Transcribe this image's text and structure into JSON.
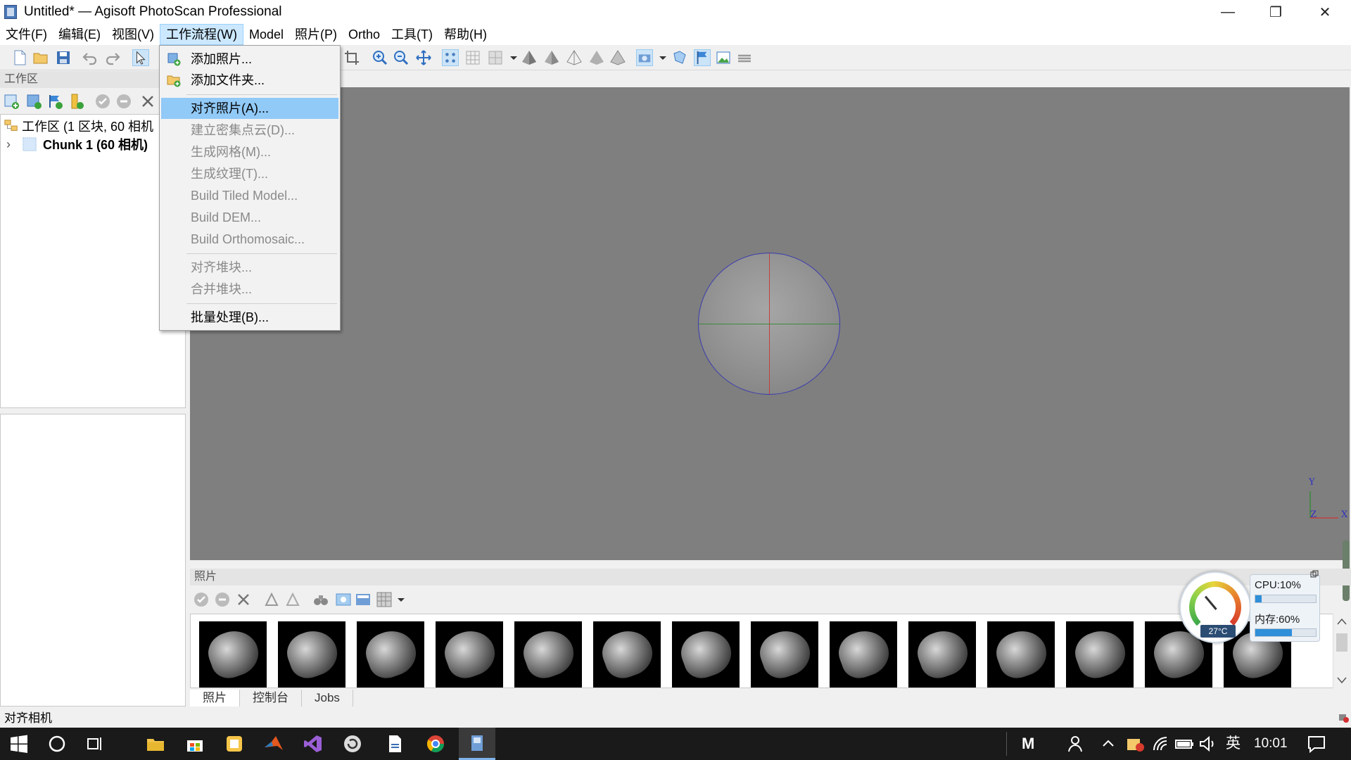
{
  "window": {
    "title": "Untitled* — Agisoft PhotoScan Professional",
    "controls": {
      "minimize": "—",
      "maximize": "❐",
      "close": "✕"
    }
  },
  "menubar": {
    "items": [
      {
        "label": "文件(F)"
      },
      {
        "label": "编辑(E)"
      },
      {
        "label": "视图(V)"
      },
      {
        "label": "工作流程(W)"
      },
      {
        "label": "Model"
      },
      {
        "label": "照片(P)"
      },
      {
        "label": "Ortho"
      },
      {
        "label": "工具(T)"
      },
      {
        "label": "帮助(H)"
      }
    ]
  },
  "workflow_menu": {
    "add_photos": "添加照片...",
    "add_folder": "添加文件夹...",
    "align_photos": "对齐照片(A)...",
    "build_dense_cloud": "建立密集点云(D)...",
    "build_mesh": "生成网格(M)...",
    "build_texture": "生成纹理(T)...",
    "build_tiled_model": "Build Tiled Model...",
    "build_dem": "Build DEM...",
    "build_orthomosaic": "Build Orthomosaic...",
    "align_chunks": "对齐堆块...",
    "merge_chunks": "合并堆块...",
    "batch_process": "批量处理(B)..."
  },
  "workspace": {
    "header": "工作区",
    "root_label": "工作区 (1 区块, 60 相机",
    "chunk_label": "Chunk 1 (60 相机)",
    "expand_glyph": "›"
  },
  "viewport": {
    "axes": {
      "y": "Y",
      "z": "Z",
      "x": "X"
    }
  },
  "photos_panel": {
    "header": "照片",
    "tabs": [
      "照片",
      "控制台",
      "Jobs"
    ],
    "thumbnail_count": 14
  },
  "status": {
    "text": "对齐相机"
  },
  "monitor": {
    "cpu_label": "CPU:10%",
    "mem_label": "内存:60%",
    "cpu_fraction": 0.1,
    "mem_fraction": 0.6,
    "temperature": "27°C"
  },
  "taskbar": {
    "ime": "英",
    "time": "10:01",
    "m_label": "M"
  },
  "colors": {
    "viewport_bg": "#7f7f7f",
    "menu_highlight": "#91c9f7",
    "active_menu": "#cce8ff",
    "axis_x": "#c24040",
    "axis_y": "#3c8a3c",
    "axis_z": "#3030c0"
  }
}
